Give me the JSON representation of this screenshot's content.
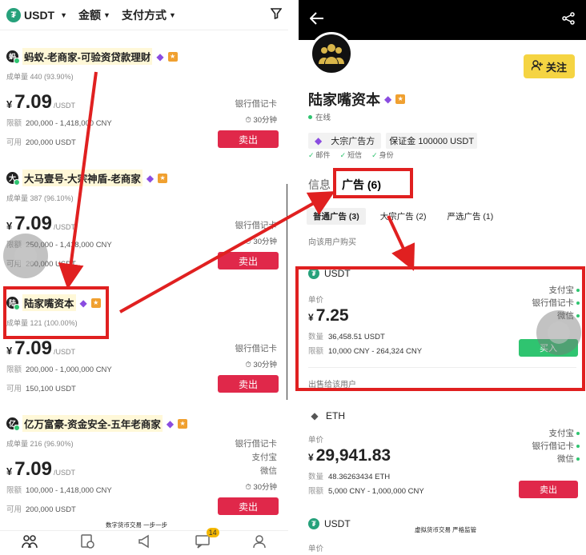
{
  "left": {
    "filter_bar": {
      "coin": "USDT",
      "amount": "金额",
      "payment": "支付方式"
    },
    "merchants": [
      {
        "name": "蚂蚁-老商家-可验资贷款理财",
        "avatar_char": "蚂",
        "volume_label": "成单量",
        "volume": "440 (93.90%)",
        "price": "7.09",
        "unit": "/USDT",
        "payments": [
          "银行借记卡"
        ],
        "limit_label": "限额",
        "limit": "200,000 - 1,418,000 CNY",
        "time": "30分钟",
        "avail_label": "可用",
        "avail": "200,000 USDT",
        "action": "卖出"
      },
      {
        "name": "大马壹号-大宗神盾-老商家",
        "avatar_char": "大",
        "volume_label": "成单量",
        "volume": "387 (96.10%)",
        "price": "7.09",
        "unit": "/USDT",
        "payments": [
          "银行借记卡"
        ],
        "limit_label": "限额",
        "limit": "250,000 - 1,418,000 CNY",
        "time": "30分钟",
        "avail_label": "可用",
        "avail": "200,000 USDT",
        "action": "卖出"
      },
      {
        "name": "陆家嘴资本",
        "avatar_char": "陆",
        "volume_label": "成单量",
        "volume": "121 (100.00%)",
        "price": "7.09",
        "unit": "/USDT",
        "payments": [
          "银行借记卡"
        ],
        "limit_label": "限额",
        "limit": "200,000 - 1,000,000 CNY",
        "time": "30分钟",
        "avail_label": "可用",
        "avail": "150,100 USDT",
        "action": "卖出"
      },
      {
        "name": "亿万富豪-资金安全-五年老商家",
        "avatar_char": "亿",
        "volume_label": "成单量",
        "volume": "216 (96.90%)",
        "price": "7.09",
        "unit": "/USDT",
        "payments": [
          "银行借记卡",
          "支付宝",
          "微信"
        ],
        "limit_label": "限额",
        "limit": "100,000 - 1,418,000 CNY",
        "time": "30分钟",
        "avail_label": "可用",
        "avail": "200,000 USDT",
        "action": "卖出"
      }
    ],
    "nav_badge": "14",
    "caption": "数字货币交易 一步一步"
  },
  "right": {
    "name": "陆家嘴资本",
    "status": "在线",
    "follow": "关注",
    "tag_bulk": "大宗广告方",
    "tag_deposit": "保证金 100000 USDT",
    "verifications": [
      "邮件",
      "短信",
      "身份"
    ],
    "tab_info": "信息",
    "tab_ads": "广告 (6)",
    "subtabs": [
      "普通广告 (3)",
      "大宗广告 (2)",
      "严选广告 (1)"
    ],
    "buy_hint": "向该用户购买",
    "ads": [
      {
        "coin": "USDT",
        "price_label": "单价",
        "price": "7.25",
        "qty_label": "数量",
        "qty": "36,458.51 USDT",
        "limit_label": "限额",
        "limit": "10,000 CNY - 264,324 CNY",
        "payments": [
          "支付宝",
          "银行借记卡",
          "微信"
        ],
        "action": "买入"
      },
      {
        "coin": "ETH",
        "price_label": "单价",
        "price": "29,941.83",
        "qty_label": "数量",
        "qty": "48.36263434 ETH",
        "limit_label": "限额",
        "limit": "5,000 CNY - 1,000,000 CNY",
        "payments": [
          "支付宝",
          "银行借记卡",
          "微信"
        ],
        "action": "卖出"
      },
      {
        "coin": "USDT",
        "price_label": "单价"
      }
    ],
    "sell_hint": "出售给该用户",
    "caption": "虚拟货币交易 严格监管"
  },
  "colors": {
    "sell": "#e0284a",
    "buy": "#2fc470",
    "follow": "#f5d442",
    "highlight": "#e02020"
  }
}
